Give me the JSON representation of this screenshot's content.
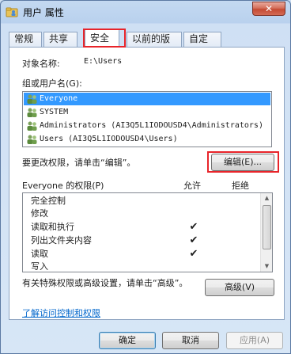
{
  "window": {
    "title": "用户 属性",
    "close_symbol": "✕"
  },
  "tabs": [
    {
      "label": "常规",
      "active": false
    },
    {
      "label": "共享",
      "active": false
    },
    {
      "label": "安全",
      "active": true
    },
    {
      "label": "以前的版本",
      "active": false
    },
    {
      "label": "自定义",
      "active": false
    }
  ],
  "security": {
    "object_label": "对象名称:",
    "object_value": "E:\\Users",
    "group_label": "组或用户名(G):",
    "users": [
      {
        "name": "Everyone",
        "selected": true,
        "icon": "users-group-icon"
      },
      {
        "name": "SYSTEM",
        "selected": false,
        "icon": "users-group-icon"
      },
      {
        "name": "Administrators (AI3Q5L1IODOUSD4\\Administrators)",
        "selected": false,
        "icon": "users-group-icon"
      },
      {
        "name": "Users (AI3Q5L1IODOUSD4\\Users)",
        "selected": false,
        "icon": "users-group-icon"
      }
    ],
    "change_text": "要更改权限，请单击“编辑”。",
    "edit_button": "编辑(E)...",
    "perm_title": "Everyone 的权限(P)",
    "allow_header": "允许",
    "deny_header": "拒绝",
    "permissions": [
      {
        "name": "完全控制",
        "allow": false
      },
      {
        "name": "修改",
        "allow": false
      },
      {
        "name": "读取和执行",
        "allow": true
      },
      {
        "name": "列出文件夹内容",
        "allow": true
      },
      {
        "name": "读取",
        "allow": true
      },
      {
        "name": "写入",
        "allow": false
      }
    ],
    "check_symbol": "✔",
    "special_text": "有关特殊权限或高级设置，请单击“高级”。",
    "advanced_button": "高级(V)",
    "link_text": "了解访问控制和权限"
  },
  "buttons": {
    "ok": "确定",
    "cancel": "取消",
    "apply": "应用(A)"
  },
  "colors": {
    "selection": "#3399ff",
    "highlight_border": "#e8242a",
    "link": "#0066cc"
  }
}
